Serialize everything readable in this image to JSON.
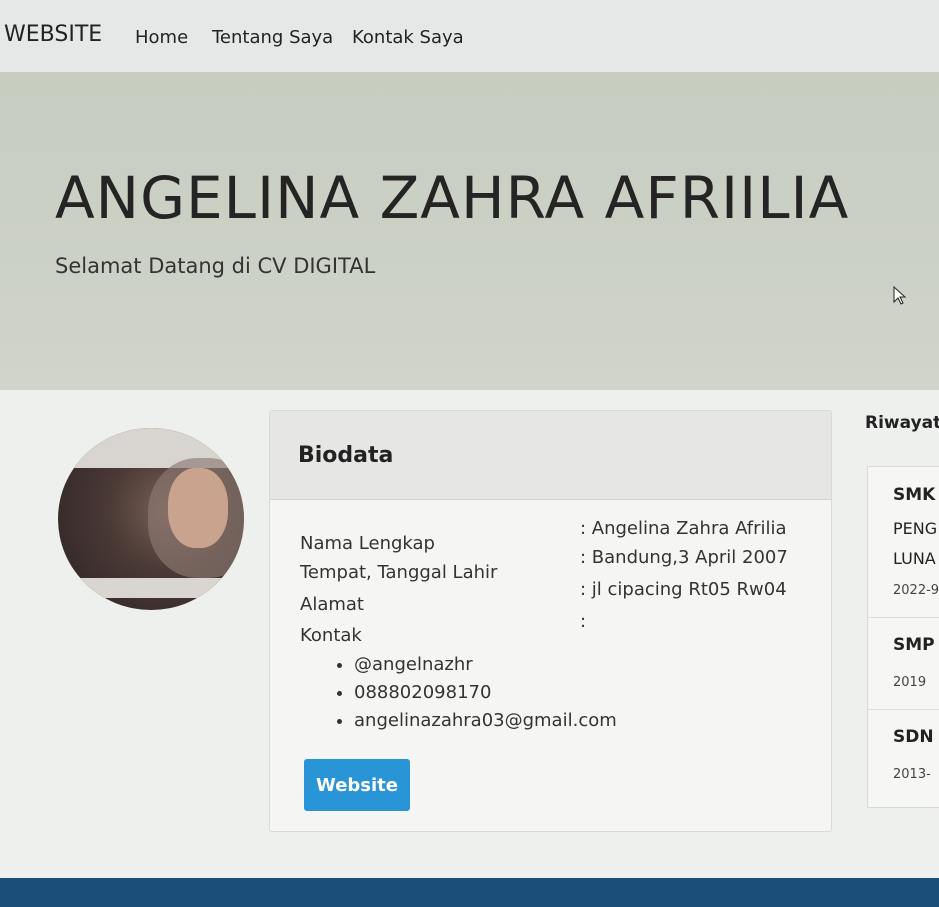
{
  "navbar": {
    "brand": "WEBSITE",
    "links": [
      "Home",
      "Tentang Saya",
      "Kontak Saya"
    ]
  },
  "hero": {
    "title": "ANGELINA ZAHRA AFRIILIA",
    "subtitle": "Selamat Datang di CV DIGITAL"
  },
  "biodata": {
    "header": "Biodata",
    "rows": [
      {
        "label": "Nama Lengkap",
        "value": ": Angelina Zahra Afrilia"
      },
      {
        "label": "Tempat, Tanggal Lahir",
        "value": ": Bandung,3 April 2007"
      },
      {
        "label": "Alamat",
        "value": ": jl cipacing Rt05 Rw04"
      },
      {
        "label": "Kontak",
        "value": ":"
      }
    ],
    "contacts": [
      "@angelnazhr",
      "088802098170",
      "angelinazahra03@gmail.com"
    ],
    "button_label": "Website"
  },
  "riwayat": {
    "title": "Riwayat",
    "items": [
      {
        "school": "SMK I",
        "major_line1": "PENG",
        "major_line2": "LUNA",
        "years": "2022-9"
      },
      {
        "school": "SMP",
        "years": "2019"
      },
      {
        "school": "SDN",
        "years": "2013-"
      }
    ]
  },
  "colors": {
    "button": "#2a95d6",
    "hero_bg": "#c7cdc0",
    "footer": "#1b4f7a"
  }
}
